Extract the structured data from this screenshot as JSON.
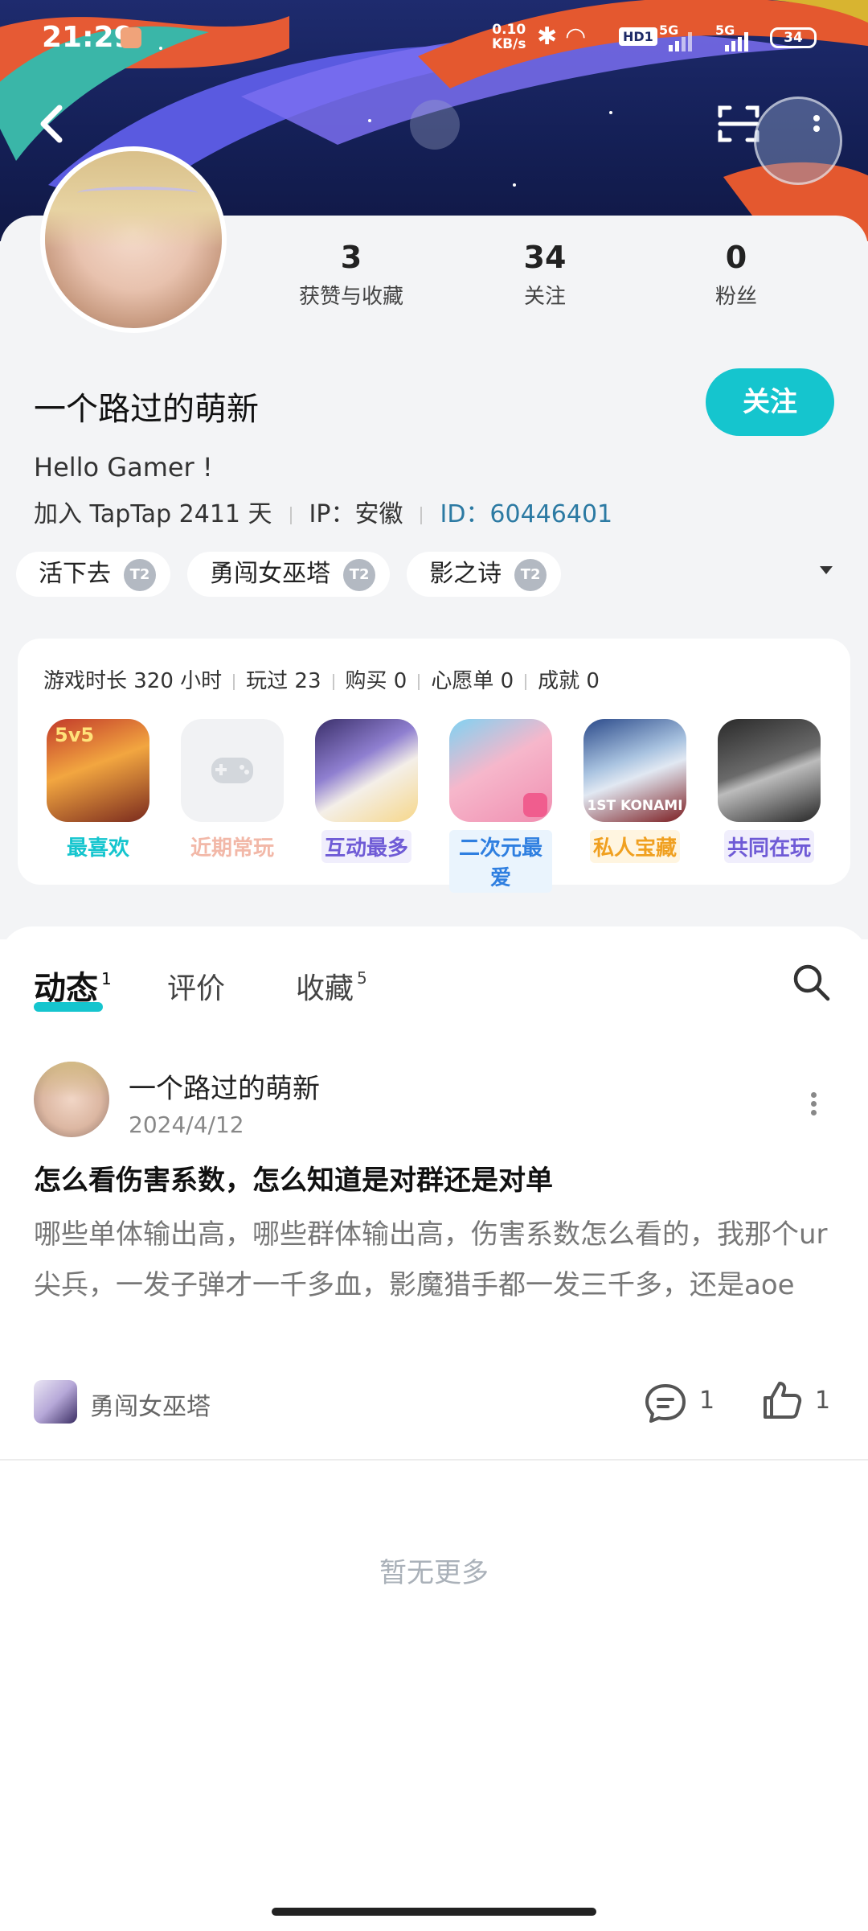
{
  "status_bar": {
    "time": "21:29",
    "net_speed_value": "0.10",
    "net_speed_unit": "KB/s",
    "hd_label": "HD1",
    "sim1": "5G",
    "sim2": "5G",
    "battery": "34"
  },
  "header": {
    "back_icon": "back-arrow-icon",
    "scan_icon": "scan-icon",
    "more_icon": "more-vertical-icon"
  },
  "profile": {
    "username": "一个路过的萌新",
    "bio": "Hello Gamer !",
    "join_text": "加入 TapTap 2411 天",
    "ip_text": "IP：安徽",
    "id_text": "ID：60446401",
    "follow_button": "关注",
    "stats": [
      {
        "value": "3",
        "label": "获赞与收藏"
      },
      {
        "value": "34",
        "label": "关注"
      },
      {
        "value": "0",
        "label": "粉丝"
      }
    ],
    "tags": [
      {
        "label": "活下去",
        "badge": "T2"
      },
      {
        "label": "勇闯女巫塔",
        "badge": "T2"
      },
      {
        "label": "影之诗",
        "badge": "T2"
      }
    ]
  },
  "games_summary": {
    "stats": [
      "游戏时长 320 小时",
      "玩过 23",
      "购买 0",
      "心愿单 0",
      "成就 0"
    ],
    "games": [
      {
        "label": "最喜欢",
        "icon_text": "5v5",
        "color": "#15c5ce"
      },
      {
        "label": "近期常玩",
        "icon_text": "",
        "color": "#f2b8a8"
      },
      {
        "label": "互动最多",
        "icon_text": "",
        "color": "#6f5bd6"
      },
      {
        "label": "二次元最爱",
        "icon_text": "",
        "color": "#2f7fe0"
      },
      {
        "label": "私人宝藏",
        "icon_text": "1ST KONAMI",
        "color": "#f0a020"
      },
      {
        "label": "共同在玩",
        "icon_text": "",
        "color": "#6f5bd6"
      }
    ]
  },
  "tabs": [
    {
      "label": "动态",
      "count": "1"
    },
    {
      "label": "评价",
      "count": ""
    },
    {
      "label": "收藏",
      "count": "5"
    }
  ],
  "post": {
    "author": "一个路过的萌新",
    "date": "2024/4/12",
    "title": "怎么看伤害系数，怎么知道是对群还是对单",
    "body": "哪些单体输出高，哪些群体输出高，伤害系数怎么看的，我那个ur尖兵，一发子弹才一千多血，影魔猎手都一发三千多，还是aoe",
    "game": "勇闯女巫塔",
    "comments": "1",
    "likes": "1"
  },
  "footer": {
    "no_more": "暂无更多"
  },
  "colors": {
    "accent": "#15c5ce",
    "id_link": "#2c7aa3"
  }
}
